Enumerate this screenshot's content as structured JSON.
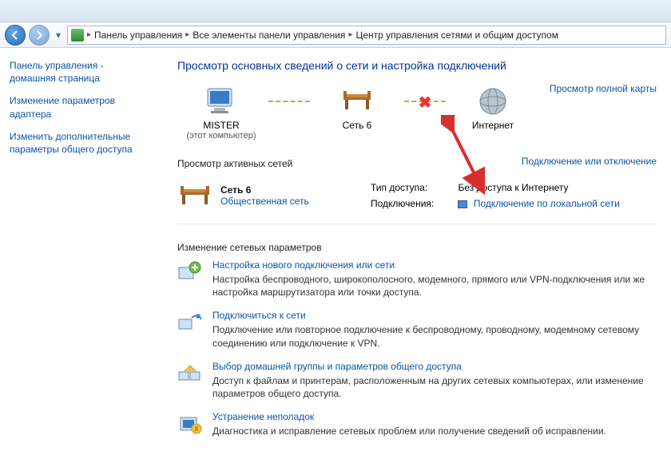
{
  "breadcrumbs": {
    "seg1": "Панель управления",
    "seg2": "Все элементы панели управления",
    "seg3": "Центр управления сетями и общим доступом"
  },
  "sidebar": {
    "home": "Панель управления - домашняя страница",
    "adapter": "Изменение параметров адаптера",
    "sharing": "Изменить дополнительные параметры общего доступа"
  },
  "main": {
    "heading": "Просмотр основных сведений о сети и настройка подключений",
    "map_link": "Просмотр полной карты",
    "nodes": {
      "pc_name": "MISTER",
      "pc_sub": "(этот компьютер)",
      "net_name": "Сеть 6",
      "internet": "Интернет"
    },
    "active_label": "Просмотр активных сетей",
    "connect_toggle": "Подключение или отключение",
    "active_net": {
      "name": "Сеть 6",
      "type": "Общественная сеть"
    },
    "conn": {
      "access_label": "Тип доступа:",
      "access_value": "Без доступа к Интернету",
      "conn_label": "Подключения:",
      "conn_value": "Подключение по локальной сети"
    },
    "params_label": "Изменение сетевых параметров",
    "tasks": [
      {
        "title": "Настройка нового подключения или сети",
        "desc": "Настройка беспроводного, широкополосного, модемного, прямого или VPN-подключения или же настройка маршрутизатора или точки доступа."
      },
      {
        "title": "Подключиться к сети",
        "desc": "Подключение или повторное подключение к беспроводному, проводному, модемному сетевому соединению или подключение к VPN."
      },
      {
        "title": "Выбор домашней группы и параметров общего доступа",
        "desc": "Доступ к файлам и принтерам, расположенным на других сетевых компьютерах, или изменение параметров общего доступа."
      },
      {
        "title": "Устранение неполадок",
        "desc": "Диагностика и исправление сетевых проблем или получение сведений об исправлении."
      }
    ]
  }
}
